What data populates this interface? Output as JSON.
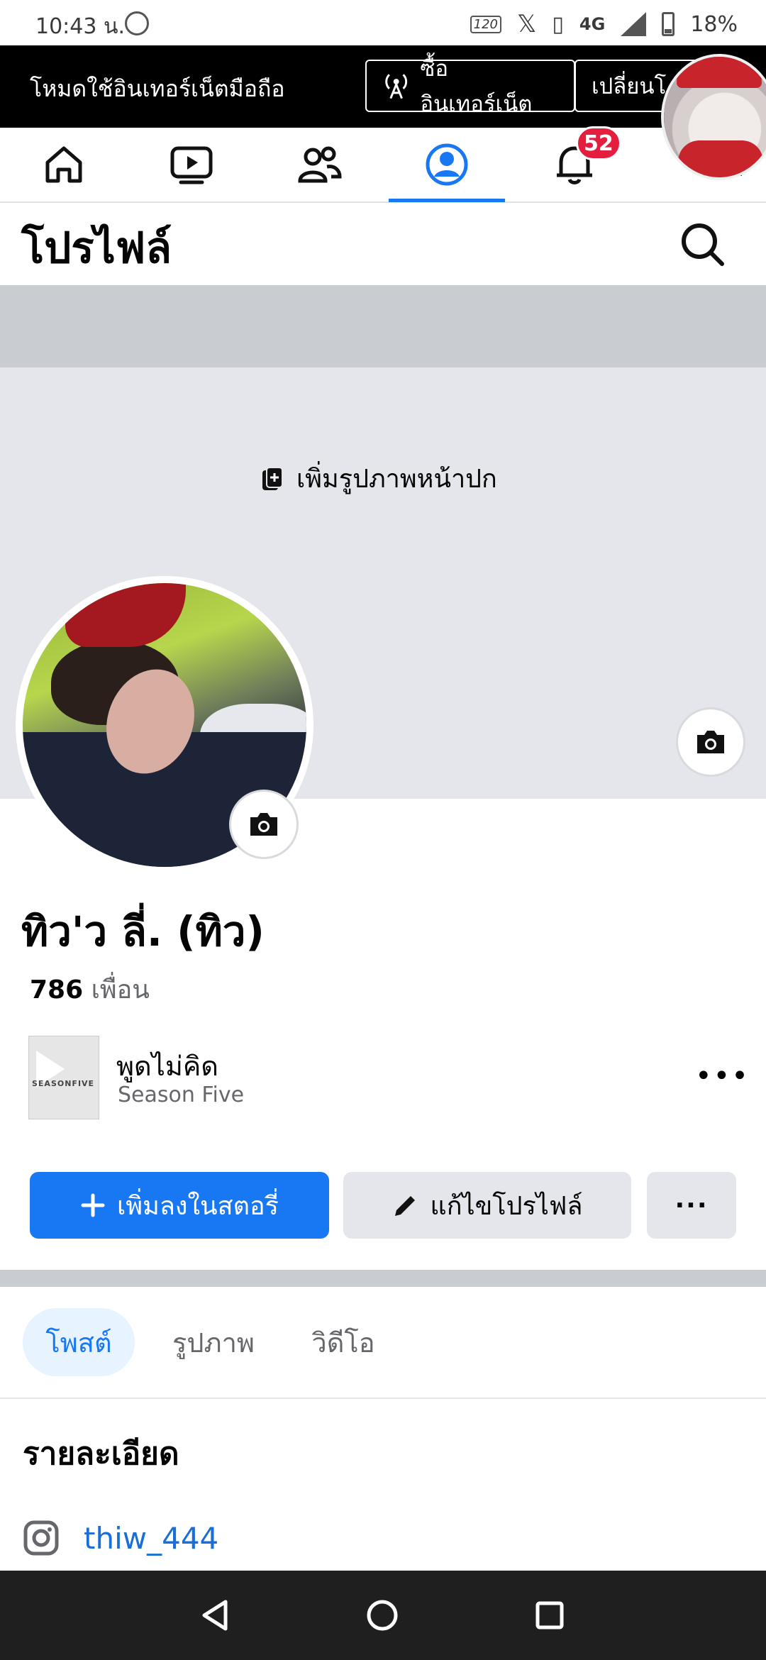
{
  "status_bar": {
    "time": "10:43 น.",
    "refresh": "120",
    "network": "4G",
    "battery": "18%"
  },
  "data_banner": {
    "label": "โหมดใช้อินเทอร์เน็ตมือถือ",
    "buy_button": "ซื้ออินเทอร์เน็ต",
    "switch_button": "เปลี่ยนโ"
  },
  "nav": {
    "notifications_count": "52",
    "active_tab": "profile"
  },
  "header": {
    "title": "โปรไฟล์"
  },
  "cover": {
    "add_cover_label": "เพิ่มรูปภาพหน้าปก"
  },
  "profile": {
    "name": "ทิว'ว ลี่. (ทิว)",
    "friends_count": "786",
    "friends_label": "เพื่อน"
  },
  "music": {
    "title": "พูดไม่คิด",
    "artist": "Season Five",
    "thumb_text": "SEASONFIVE"
  },
  "actions": {
    "add_story": "เพิ่มลงในสตอรี่",
    "edit_profile": "แก้ไขโปรไฟล์",
    "more": "..."
  },
  "tabs": [
    {
      "label": "โพสต์"
    },
    {
      "label": "รูปภาพ"
    },
    {
      "label": "วิดีโอ"
    }
  ],
  "details": {
    "heading": "รายละเอียด",
    "instagram": "thiw_444"
  },
  "colors": {
    "accent": "#1877f2",
    "badge": "#e41e3f",
    "cover": "#e4e6eb"
  }
}
